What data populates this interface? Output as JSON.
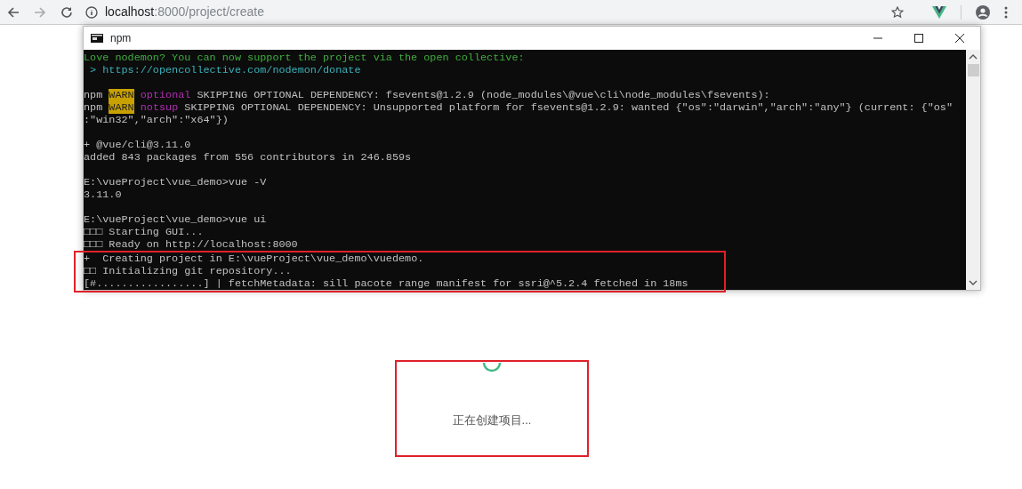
{
  "browser": {
    "url_host": "localhost",
    "url_path": ":8000/project/create"
  },
  "console": {
    "title": "npm",
    "lines": [
      {
        "kind": "text",
        "segments": [
          {
            "kind": "green",
            "text": "Love nodemon? You can now support the project via the open collective:"
          }
        ]
      },
      {
        "kind": "text",
        "segments": [
          {
            "kind": "cyan",
            "text": " > https://opencollective.com/nodemon/donate"
          }
        ]
      },
      {
        "kind": "blank"
      },
      {
        "kind": "text",
        "segments": [
          {
            "kind": "plain",
            "text": "npm "
          },
          {
            "kind": "warn",
            "text": "WARN"
          },
          {
            "kind": "magenta",
            "text": " optional"
          },
          {
            "kind": "plain",
            "text": " SKIPPING OPTIONAL DEPENDENCY: fsevents@1.2.9 (node_modules\\@vue\\cli\\node_modules\\fsevents):"
          }
        ]
      },
      {
        "kind": "text",
        "segments": [
          {
            "kind": "plain",
            "text": "npm "
          },
          {
            "kind": "warn",
            "text": "WARN"
          },
          {
            "kind": "magenta",
            "text": " notsup"
          },
          {
            "kind": "plain",
            "text": " SKIPPING OPTIONAL DEPENDENCY: Unsupported platform for fsevents@1.2.9: wanted {\"os\":\"darwin\",\"arch\":\"any\"} (current: {\"os\""
          }
        ]
      },
      {
        "kind": "text",
        "segments": [
          {
            "kind": "plain",
            "text": ":\"win32\",\"arch\":\"x64\"})"
          }
        ]
      },
      {
        "kind": "blank"
      },
      {
        "kind": "text",
        "segments": [
          {
            "kind": "plain",
            "text": "+ @vue/cli@3.11.0"
          }
        ]
      },
      {
        "kind": "text",
        "segments": [
          {
            "kind": "plain",
            "text": "added 843 packages from 556 contributors in 246.859s"
          }
        ]
      },
      {
        "kind": "blank"
      },
      {
        "kind": "text",
        "segments": [
          {
            "kind": "plain",
            "text": "E:\\vueProject\\vue_demo>vue -V"
          }
        ]
      },
      {
        "kind": "text",
        "segments": [
          {
            "kind": "plain",
            "text": "3.11.0"
          }
        ]
      },
      {
        "kind": "blank"
      },
      {
        "kind": "text",
        "segments": [
          {
            "kind": "plain",
            "text": "E:\\vueProject\\vue_demo>vue ui"
          }
        ]
      },
      {
        "kind": "text",
        "segments": [
          {
            "kind": "plain",
            "text": "□□□ Starting GUI..."
          }
        ]
      },
      {
        "kind": "text",
        "segments": [
          {
            "kind": "plain",
            "text": "□□□ Ready on http://localhost:8000"
          }
        ]
      }
    ],
    "highlighted_lines": [
      [
        {
          "kind": "plain",
          "text": "+"
        },
        {
          "kind": "plain",
          "text": "  Creating project in E:\\vueProject\\vue_demo\\vuedemo."
        }
      ],
      [
        {
          "kind": "plain",
          "text": "□□ Initializing git repository..."
        }
      ],
      [
        {
          "kind": "plain",
          "text": "[#.................] | fetchMetadata: sill pacote range manifest for ssri@^5.2.4 fetched in 18ms"
        }
      ]
    ]
  },
  "loading": {
    "message": "正在创建项目...",
    "highlighted": true
  }
}
